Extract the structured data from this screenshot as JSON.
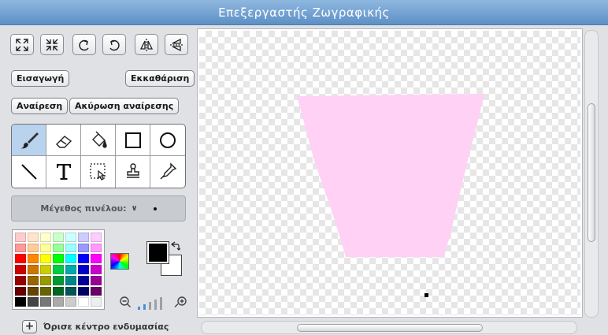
{
  "window": {
    "title": "Επεξεργαστής Ζωγραφικής"
  },
  "toolbar": {
    "buttons": [
      {
        "name": "grow-icon"
      },
      {
        "name": "shrink-icon"
      },
      {
        "name": "rotate-left-icon"
      },
      {
        "name": "rotate-right-icon"
      },
      {
        "name": "flip-horizontal-icon"
      },
      {
        "name": "flip-vertical-icon"
      }
    ],
    "import_label": "Εισαγωγή",
    "clear_label": "Εκκαθάριση",
    "undo_label": "Αναίρεση",
    "redo_label": "Ακύρωση αναίρεσης"
  },
  "tools": {
    "selected": "paintbrush",
    "items": [
      "paintbrush",
      "eraser",
      "fill",
      "rectangle",
      "ellipse",
      "line",
      "text",
      "select",
      "stamp",
      "eyedropper"
    ]
  },
  "brush_size": {
    "label": "Μέγεθος πινέλου:"
  },
  "palette": {
    "colors": [
      "#ffcccc",
      "#ffe5cc",
      "#ffffcc",
      "#ccffcc",
      "#ccffff",
      "#ccccff",
      "#ffccff",
      "#ff9999",
      "#ffcc99",
      "#ffff99",
      "#99ff99",
      "#99ffff",
      "#9999ff",
      "#ff99ff",
      "#ff0000",
      "#ff8800",
      "#ffff00",
      "#00ff00",
      "#00ffff",
      "#0000ff",
      "#ff00ff",
      "#cc0000",
      "#cc7700",
      "#cccc00",
      "#00cc44",
      "#00aaaa",
      "#0000cc",
      "#cc00cc",
      "#990000",
      "#996600",
      "#999900",
      "#009933",
      "#008888",
      "#000099",
      "#990099",
      "#660000",
      "#664400",
      "#666600",
      "#006622",
      "#005555",
      "#000066",
      "#660066",
      "#000000",
      "#444444",
      "#777777",
      "#aaaaaa",
      "#cccccc",
      "#ffffff",
      "#eeeeee"
    ],
    "foreground": "#000000",
    "background": "#ffffff"
  },
  "zoom": {
    "level_bars": 5,
    "active_bars": 2
  },
  "set_center": {
    "label": "Όρισε κέντρο ενδυμασίας"
  },
  "canvas": {
    "shape_color": "#ffd1f5"
  }
}
